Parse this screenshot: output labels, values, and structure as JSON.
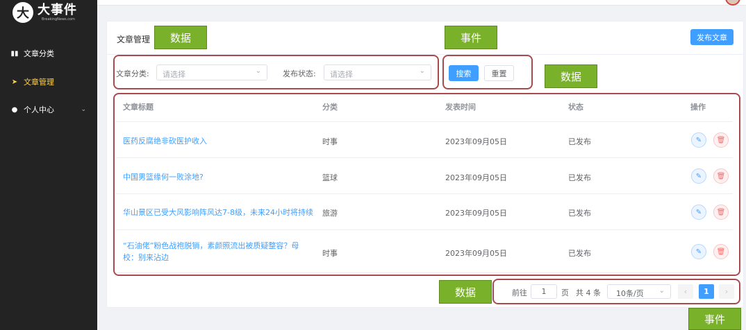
{
  "sidebar": {
    "logo_mark": "大",
    "logo_title": "大事件",
    "logo_subtitle": "BreakingNews.com",
    "items": [
      {
        "label": "文章分类",
        "icon": "category-icon"
      },
      {
        "label": "文章管理",
        "icon": "send-icon",
        "active": true
      },
      {
        "label": "个人中心",
        "icon": "user-icon",
        "expandable": true
      }
    ]
  },
  "card": {
    "title": "文章管理",
    "publish_label": "发布文章"
  },
  "filters": {
    "category_label": "文章分类:",
    "category_placeholder": "请选择",
    "status_label": "发布状态:",
    "status_placeholder": "请选择",
    "search_label": "搜索",
    "reset_label": "重置"
  },
  "table": {
    "columns": [
      "文章标题",
      "分类",
      "发表时间",
      "状态",
      "操作"
    ],
    "rows": [
      {
        "title": "医药反腐绝非砍医护收入",
        "category": "时事",
        "date": "2023年09月05日",
        "status": "已发布"
      },
      {
        "title": "中国男篮缘何一败涂地?",
        "category": "篮球",
        "date": "2023年09月05日",
        "status": "已发布"
      },
      {
        "title": "华山景区已受大风影响阵风达7-8级，未来24小时将持续",
        "category": "旅游",
        "date": "2023年09月05日",
        "status": "已发布"
      },
      {
        "title": "“石油佬”粉色战袍脱销，素颜照流出被质疑整容？母校：别来沾边",
        "category": "时事",
        "date": "2023年09月05日",
        "status": "已发布"
      }
    ]
  },
  "pagination": {
    "goto_label": "前往",
    "goto_value": "1",
    "page_unit": "页",
    "total": "共 4 条",
    "page_size": "10条/页",
    "current_page": "1"
  },
  "annotations": {
    "data_tag": "数据",
    "event_tag": "事件"
  },
  "colors": {
    "primary": "#409eff",
    "sidebar_bg": "#232323",
    "active_menu": "#ffd04b",
    "annotation_border": "#a94a4f",
    "annotation_tag": "#7ab12a"
  }
}
